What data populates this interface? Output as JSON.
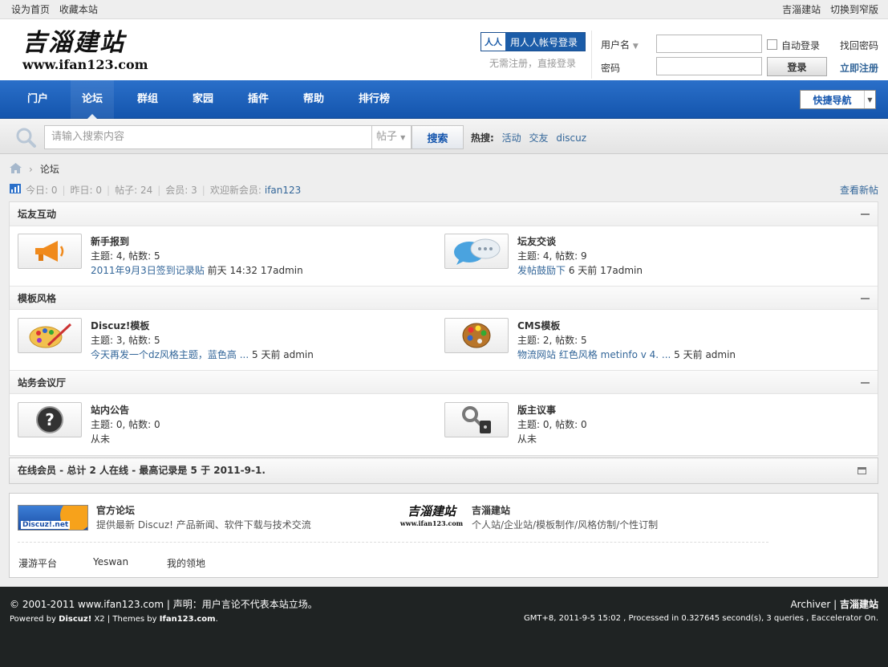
{
  "topbar": {
    "set_home": "设为首页",
    "bookmark": "收藏本站",
    "site_name": "吉淄建站",
    "switch_width": "切换到窄版"
  },
  "header": {
    "logo_text": "吉淄建站",
    "logo_url": "www.ifan123.com",
    "renren_login": "用人人帐号登录",
    "no_register": "无需注册，直接登录",
    "username_label": "用户名",
    "password_label": "密码",
    "auto_login": "自动登录",
    "login_button": "登录",
    "find_password": "找回密码",
    "register_now": "立即注册"
  },
  "nav": {
    "items": [
      "门户",
      "论坛",
      "群组",
      "家园",
      "插件",
      "帮助",
      "排行榜"
    ],
    "active": "论坛",
    "quick_nav": "快捷导航"
  },
  "search": {
    "placeholder": "请输入搜索内容",
    "type": "帖子",
    "button": "搜索",
    "hot_label": "热搜:",
    "hot_words": [
      "活动",
      "交友",
      "discuz"
    ]
  },
  "breadcrumb": {
    "current": "论坛"
  },
  "stats": {
    "today": "今日: 0",
    "yesterday": "昨日: 0",
    "posts": "帖子: 24",
    "members": "会员: 3",
    "welcome": "欢迎新会员:",
    "new_member": "ifan123",
    "view_new": "查看新帖"
  },
  "categories": [
    {
      "name": "坛友互动",
      "forums": [
        {
          "title": "新手报到",
          "meta": "主题: 4, 帖数: 5",
          "last_link": "2011年9月3日签到记录贴",
          "last_info": " 前天 14:32 17admin",
          "icon": "megaphone-icon"
        },
        {
          "title": "坛友交谈",
          "meta": "主题: 4, 帖数: 9",
          "last_link": "发帖鼓励下",
          "last_info": " 6 天前 17admin",
          "icon": "chat-bubbles-icon"
        }
      ]
    },
    {
      "name": "模板风格",
      "forums": [
        {
          "title": "Discuz!模板",
          "meta": "主题: 3, 帖数: 5",
          "last_link": "今天再发一个dz风格主题，蓝色高 ...",
          "last_info": " 5 天前 admin",
          "icon": "palette-brush-icon"
        },
        {
          "title": "CMS模板",
          "meta": "主题: 2, 帖数: 5",
          "last_link": "物流网站 红色风格 metinfo v 4. ...",
          "last_info": " 5 天前 admin",
          "icon": "palette-icon"
        }
      ]
    },
    {
      "name": "站务会议厅",
      "forums": [
        {
          "title": "站内公告",
          "meta": "主题: 0, 帖数: 0",
          "last_link": "",
          "last_info": "从未",
          "icon": "question-icon"
        },
        {
          "title": "版主议事",
          "meta": "主题: 0, 帖数: 0",
          "last_link": "",
          "last_info": "从未",
          "icon": "key-lock-icon"
        }
      ]
    }
  ],
  "online": {
    "text": "在线会员 - 总计 2 人在线 - 最高记录是 5 于 2011-9-1."
  },
  "friend_links": {
    "featured": [
      {
        "name": "官方论坛",
        "desc": "提供最新 Discuz! 产品新闻、软件下载与技术交流",
        "logo_text": "Discuz!.net"
      },
      {
        "name": "吉淄建站",
        "desc": "个人站/企业站/模板制作/风格仿制/个性订制",
        "logo_text": "吉淄建站",
        "logo_url": "www.ifan123.com"
      }
    ],
    "text_links": [
      "漫游平台",
      "Yeswan",
      "我的领地"
    ]
  },
  "footer": {
    "copyright": "© 2001-2011 www.ifan123.com",
    "statement": "声明：用户言论不代表本站立场。",
    "powered_label": "Powered by",
    "powered_by": "Discuz!",
    "powered_version": "X2",
    "themes_label": "Themes by",
    "themes_by": "Ifan123.com",
    "archiver": "Archiver",
    "site": "吉淄建站",
    "runtime": "GMT+8, 2011-9-5 15:02 , Processed in 0.327645 second(s), 3 queries , Eaccelerator On."
  }
}
